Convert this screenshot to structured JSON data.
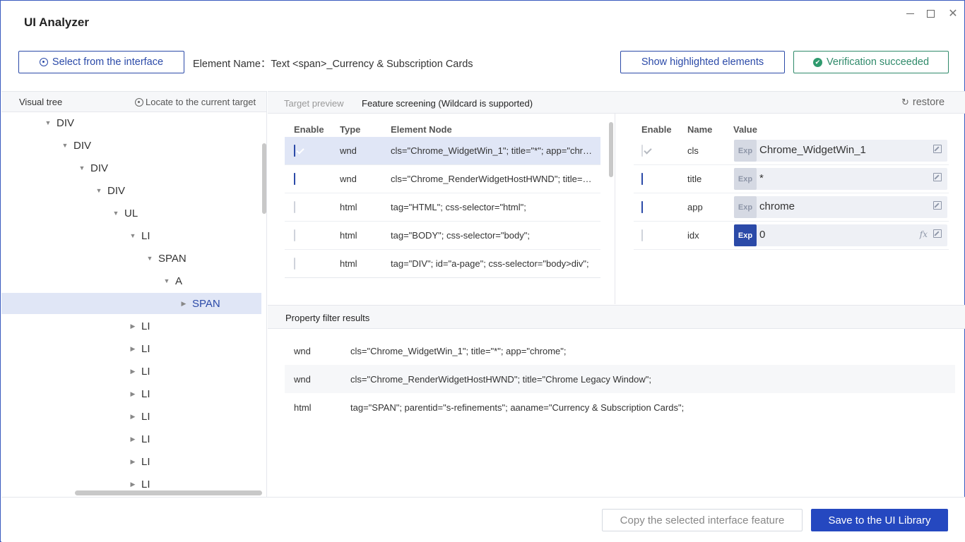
{
  "app": {
    "title": "UI Analyzer",
    "window_controls": {
      "minimize": "minimize",
      "maximize": "maximize",
      "close": "✕"
    }
  },
  "toolbar": {
    "select_label": "Select from the interface",
    "element_name": "Element Name：Text <span>_Currency & Subscription Cards",
    "show_highlight_label": "Show highlighted elements",
    "verification_label": "Verification succeeded"
  },
  "visual_tree": {
    "title": "Visual tree",
    "locate_label": "Locate to the current target",
    "nodes": [
      {
        "label": "DIV",
        "expanded": true
      },
      {
        "label": "DIV",
        "expanded": true
      },
      {
        "label": "DIV",
        "expanded": true
      },
      {
        "label": "DIV",
        "expanded": true
      },
      {
        "label": "UL",
        "expanded": true
      },
      {
        "label": "LI",
        "expanded": true
      },
      {
        "label": "SPAN",
        "expanded": true
      },
      {
        "label": "A",
        "expanded": true
      },
      {
        "label": "SPAN",
        "expanded": false,
        "selected": true
      },
      {
        "label": "LI",
        "expanded": false
      },
      {
        "label": "LI",
        "expanded": false
      },
      {
        "label": "LI",
        "expanded": false
      },
      {
        "label": "LI",
        "expanded": false
      },
      {
        "label": "LI",
        "expanded": false
      },
      {
        "label": "LI",
        "expanded": false
      },
      {
        "label": "LI",
        "expanded": false
      },
      {
        "label": "LI",
        "expanded": false
      }
    ]
  },
  "tabs": {
    "target_preview": "Target preview",
    "feature_screening": "Feature screening (Wildcard is supported)",
    "restore": "restore"
  },
  "features": {
    "headers": {
      "enable": "Enable",
      "type": "Type",
      "node": "Element Node"
    },
    "rows": [
      {
        "enabled": true,
        "type": "wnd",
        "node": "cls=\"Chrome_WidgetWin_1\"; title=\"*\"; app=\"chrome\";",
        "highlighted": true
      },
      {
        "enabled": true,
        "type": "wnd",
        "node": "cls=\"Chrome_RenderWidgetHostHWND\"; title=\"Chrome Legacy Window\";"
      },
      {
        "enabled": false,
        "type": "html",
        "node": "tag=\"HTML\"; css-selector=\"html\";"
      },
      {
        "enabled": false,
        "type": "html",
        "node": "tag=\"BODY\"; css-selector=\"body\";"
      },
      {
        "enabled": false,
        "type": "html",
        "node": "tag=\"DIV\"; id=\"a-page\"; css-selector=\"body>div\";"
      }
    ]
  },
  "properties": {
    "headers": {
      "enable": "Enable",
      "name": "Name",
      "value": "Value"
    },
    "rows": [
      {
        "state": "disabled-checked",
        "name": "cls",
        "exp": "Exp",
        "exp_active": false,
        "value": "Chrome_WidgetWin_1"
      },
      {
        "state": "checked",
        "name": "title",
        "exp": "Exp",
        "exp_active": false,
        "value": "*"
      },
      {
        "state": "checked",
        "name": "app",
        "exp": "Exp",
        "exp_active": false,
        "value": "chrome"
      },
      {
        "state": "unchecked",
        "name": "idx",
        "exp": "Exp",
        "exp_active": true,
        "value": "0",
        "fx": "fx"
      }
    ]
  },
  "results": {
    "title": "Property filter results",
    "rows": [
      {
        "type": "wnd",
        "node": "cls=\"Chrome_WidgetWin_1\"; title=\"*\"; app=\"chrome\";"
      },
      {
        "type": "wnd",
        "node": "cls=\"Chrome_RenderWidgetHostHWND\"; title=\"Chrome Legacy Window\";"
      },
      {
        "type": "html",
        "node": "tag=\"SPAN\"; parentid=\"s-refinements\"; aaname=\"Currency & Subscription Cards\";"
      }
    ]
  },
  "footer": {
    "copy_label": "Copy the selected interface feature",
    "save_label": "Save to the UI Library"
  },
  "colors": {
    "accent": "#2b4aa8",
    "success": "#2f8a6a",
    "primary_button": "#2548c0"
  }
}
